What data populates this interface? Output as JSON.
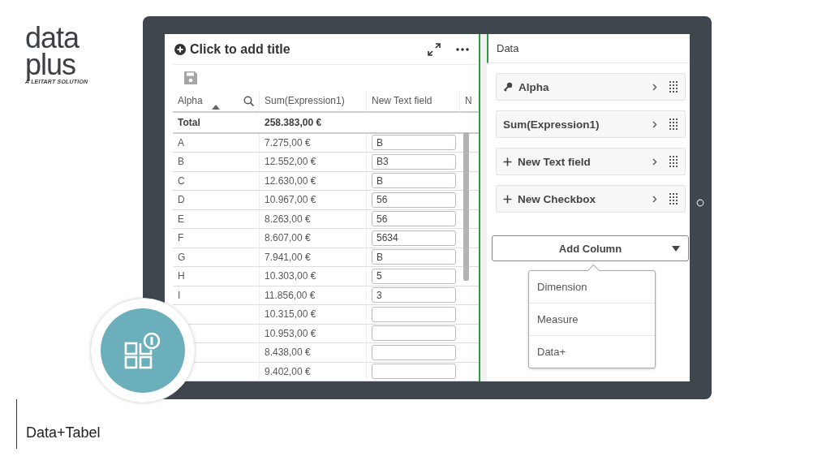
{
  "logo": {
    "line_1": "data",
    "line_2": "plus",
    "tagline": "A LEITART SOLUTION"
  },
  "sheet": {
    "title": "Click to add title",
    "table": {
      "columns": [
        "Alpha",
        "Sum(Expression1)",
        "New Text field",
        "N"
      ],
      "total": {
        "label": "Total",
        "sum": "258.383,00 €"
      },
      "rows": [
        {
          "alpha": "A",
          "sum": "7.275,00 €",
          "text": "B"
        },
        {
          "alpha": "B",
          "sum": "12.552,00 €",
          "text": "B3"
        },
        {
          "alpha": "C",
          "sum": "12.630,00 €",
          "text": "B"
        },
        {
          "alpha": "D",
          "sum": "10.967,00 €",
          "text": "56"
        },
        {
          "alpha": "E",
          "sum": "8.263,00 €",
          "text": "56"
        },
        {
          "alpha": "F",
          "sum": "8.607,00 €",
          "text": "5634"
        },
        {
          "alpha": "G",
          "sum": "7.941,00 €",
          "text": "B"
        },
        {
          "alpha": "H",
          "sum": "10.303,00 €",
          "text": "5"
        },
        {
          "alpha": "I",
          "sum": "11.856,00 €",
          "text": "3"
        },
        {
          "sum": "10.315,00 €"
        },
        {
          "sum": "10.953,00 €"
        },
        {
          "sum": "8.438,00 €"
        },
        {
          "sum": "9.402,00 €"
        }
      ]
    }
  },
  "data_panel": {
    "title": "Data",
    "items": [
      {
        "label": "Alpha",
        "kind": "dimension"
      },
      {
        "label": "Sum(Expression1)",
        "kind": "measure"
      },
      {
        "label": "New Text field",
        "kind": "new"
      },
      {
        "label": "New Checkbox",
        "kind": "new"
      }
    ],
    "add_column": {
      "label": "Add Column",
      "expanded": true
    },
    "menu": [
      {
        "label": "Dimension"
      },
      {
        "label": "Measure"
      },
      {
        "label": "Data+"
      }
    ]
  },
  "caption": "Data+Tabel"
}
